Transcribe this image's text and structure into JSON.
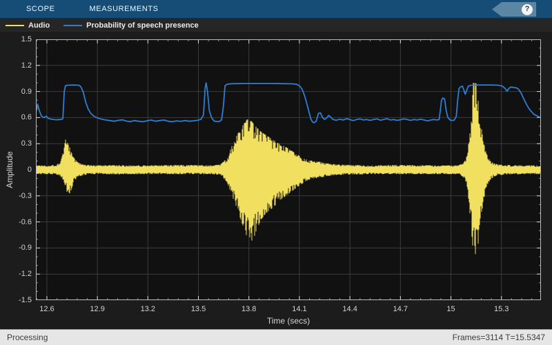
{
  "toolbar": {
    "tabs": [
      {
        "label": "SCOPE"
      },
      {
        "label": "MEASUREMENTS"
      }
    ],
    "help_label": "?"
  },
  "legend": {
    "items": [
      {
        "label": "Audio",
        "color": "#f1df5f"
      },
      {
        "label": "Probability of speech presence",
        "color": "#2e7ed4"
      }
    ]
  },
  "status_bar": {
    "left": "Processing",
    "right": "Frames=3114  T=15.5347"
  },
  "colors": {
    "plot_interior": "#111111",
    "grid": "#3c3c3c",
    "axis_border": "#bdbdbd",
    "major_tick": "#e0e0e0",
    "minor_tick": "#8f8f8f",
    "audio": "#f1df5f",
    "probability": "#2e7ed4"
  },
  "chart_data": {
    "type": "line",
    "title": "",
    "xlabel": "Time (secs)",
    "ylabel": "Amplitude",
    "xlim": [
      12.5347,
      15.5347
    ],
    "ylim": [
      -1.5,
      1.5
    ],
    "grid": true,
    "legend_position": "top-left-bar",
    "x_ticks": [
      {
        "v": 12.6,
        "label": "12.6"
      },
      {
        "v": 12.9,
        "label": "12.9"
      },
      {
        "v": 13.2,
        "label": "13.2"
      },
      {
        "v": 13.5,
        "label": "13.5"
      },
      {
        "v": 13.8,
        "label": "13.8"
      },
      {
        "v": 14.1,
        "label": "14.1"
      },
      {
        "v": 14.4,
        "label": "14.4"
      },
      {
        "v": 14.7,
        "label": "14.7"
      },
      {
        "v": 15,
        "label": "15"
      },
      {
        "v": 15.3,
        "label": "15.3"
      }
    ],
    "y_ticks": [
      {
        "v": 1.5,
        "label": "1.5"
      },
      {
        "v": 1.2,
        "label": "1.2"
      },
      {
        "v": 0.9,
        "label": "0.9"
      },
      {
        "v": 0.6,
        "label": "0.6"
      },
      {
        "v": 0.3,
        "label": "0.3"
      },
      {
        "v": 0,
        "label": "0"
      },
      {
        "v": -0.3,
        "label": "-0.3"
      },
      {
        "v": -0.6,
        "label": "-0.6"
      },
      {
        "v": -0.9,
        "label": "-0.9"
      },
      {
        "v": -1.2,
        "label": "-1.2"
      },
      {
        "v": -1.5,
        "label": "-1.5"
      }
    ],
    "x_minor_step": 0.06,
    "y_minor_step": 0.1,
    "series": [
      {
        "name": "Audio",
        "type": "waveform-envelope",
        "color": "#f1df5f",
        "envelope_format": [
          "time_secs",
          "pos_envelope",
          "neg_envelope"
        ],
        "envelope": [
          [
            12.5347,
            0.05,
            -0.05
          ],
          [
            12.6,
            0.05,
            -0.05
          ],
          [
            12.655,
            0.055,
            -0.055
          ],
          [
            12.68,
            0.09,
            -0.07
          ],
          [
            12.7,
            0.22,
            -0.13
          ],
          [
            12.712,
            0.37,
            -0.2
          ],
          [
            12.725,
            0.3,
            -0.3
          ],
          [
            12.74,
            0.24,
            -0.26
          ],
          [
            12.76,
            0.14,
            -0.14
          ],
          [
            12.78,
            0.09,
            -0.09
          ],
          [
            12.81,
            0.065,
            -0.065
          ],
          [
            12.86,
            0.05,
            -0.05
          ],
          [
            13.0,
            0.052,
            -0.052
          ],
          [
            13.2,
            0.05,
            -0.05
          ],
          [
            13.4,
            0.055,
            -0.05
          ],
          [
            13.58,
            0.05,
            -0.05
          ],
          [
            13.63,
            0.06,
            -0.06
          ],
          [
            13.67,
            0.13,
            -0.14
          ],
          [
            13.7,
            0.28,
            -0.3
          ],
          [
            13.73,
            0.4,
            -0.45
          ],
          [
            13.76,
            0.5,
            -0.62
          ],
          [
            13.79,
            0.58,
            -0.78
          ],
          [
            13.815,
            0.56,
            -0.88
          ],
          [
            13.84,
            0.5,
            -0.72
          ],
          [
            13.87,
            0.44,
            -0.58
          ],
          [
            13.9,
            0.4,
            -0.5
          ],
          [
            13.94,
            0.35,
            -0.44
          ],
          [
            13.98,
            0.3,
            -0.36
          ],
          [
            14.02,
            0.26,
            -0.3
          ],
          [
            14.06,
            0.21,
            -0.24
          ],
          [
            14.1,
            0.16,
            -0.18
          ],
          [
            14.14,
            0.12,
            -0.13
          ],
          [
            14.18,
            0.1,
            -0.1
          ],
          [
            14.22,
            0.09,
            -0.09
          ],
          [
            14.26,
            0.075,
            -0.075
          ],
          [
            14.32,
            0.06,
            -0.06
          ],
          [
            14.5,
            0.05,
            -0.05
          ],
          [
            14.7,
            0.055,
            -0.05
          ],
          [
            14.9,
            0.05,
            -0.05
          ],
          [
            15.04,
            0.05,
            -0.05
          ],
          [
            15.07,
            0.07,
            -0.08
          ],
          [
            15.09,
            0.12,
            -0.15
          ],
          [
            15.105,
            0.3,
            -0.35
          ],
          [
            15.12,
            0.55,
            -0.65
          ],
          [
            15.133,
            1.0,
            -0.97
          ],
          [
            15.158,
            0.99,
            -0.97
          ],
          [
            15.172,
            0.62,
            -0.68
          ],
          [
            15.188,
            0.38,
            -0.42
          ],
          [
            15.203,
            0.24,
            -0.27
          ],
          [
            15.22,
            0.14,
            -0.16
          ],
          [
            15.24,
            0.09,
            -0.1
          ],
          [
            15.27,
            0.065,
            -0.065
          ],
          [
            15.33,
            0.055,
            -0.055
          ],
          [
            15.45,
            0.05,
            -0.05
          ],
          [
            15.5347,
            0.05,
            -0.05
          ]
        ]
      },
      {
        "name": "Probability of speech presence",
        "type": "line",
        "color": "#2e7ed4",
        "points_format": [
          "time_secs",
          "probability"
        ],
        "points": [
          [
            12.535,
            0.66
          ],
          [
            12.545,
            0.755
          ],
          [
            12.555,
            0.68
          ],
          [
            12.567,
            0.62
          ],
          [
            12.58,
            0.6
          ],
          [
            12.597,
            0.615
          ],
          [
            12.61,
            0.59
          ],
          [
            12.63,
            0.58
          ],
          [
            12.655,
            0.575
          ],
          [
            12.68,
            0.578
          ],
          [
            12.695,
            0.585
          ],
          [
            12.703,
            0.9
          ],
          [
            12.71,
            0.965
          ],
          [
            12.72,
            0.972
          ],
          [
            12.76,
            0.975
          ],
          [
            12.79,
            0.972
          ],
          [
            12.802,
            0.955
          ],
          [
            12.815,
            0.9
          ],
          [
            12.83,
            0.78
          ],
          [
            12.845,
            0.7
          ],
          [
            12.862,
            0.645
          ],
          [
            12.88,
            0.615
          ],
          [
            12.9,
            0.597
          ],
          [
            12.925,
            0.582
          ],
          [
            12.95,
            0.572
          ],
          [
            12.975,
            0.565
          ],
          [
            13.0,
            0.558
          ],
          [
            13.025,
            0.568
          ],
          [
            13.05,
            0.574
          ],
          [
            13.07,
            0.56
          ],
          [
            13.095,
            0.553
          ],
          [
            13.12,
            0.565
          ],
          [
            13.145,
            0.558
          ],
          [
            13.17,
            0.552
          ],
          [
            13.195,
            0.563
          ],
          [
            13.22,
            0.572
          ],
          [
            13.245,
            0.558
          ],
          [
            13.27,
            0.565
          ],
          [
            13.295,
            0.572
          ],
          [
            13.32,
            0.558
          ],
          [
            13.345,
            0.552
          ],
          [
            13.37,
            0.562
          ],
          [
            13.395,
            0.556
          ],
          [
            13.42,
            0.565
          ],
          [
            13.445,
            0.558
          ],
          [
            13.47,
            0.562
          ],
          [
            13.495,
            0.568
          ],
          [
            13.515,
            0.58
          ],
          [
            13.53,
            0.63
          ],
          [
            13.54,
            0.94
          ],
          [
            13.546,
            1.0
          ],
          [
            13.554,
            0.9
          ],
          [
            13.565,
            0.68
          ],
          [
            13.578,
            0.6
          ],
          [
            13.592,
            0.562
          ],
          [
            13.61,
            0.553
          ],
          [
            13.625,
            0.556
          ],
          [
            13.638,
            0.575
          ],
          [
            13.648,
            0.72
          ],
          [
            13.658,
            0.965
          ],
          [
            13.672,
            0.985
          ],
          [
            13.7,
            0.99
          ],
          [
            13.78,
            0.992
          ],
          [
            13.86,
            0.992
          ],
          [
            13.94,
            0.992
          ],
          [
            14.02,
            0.99
          ],
          [
            14.06,
            0.988
          ],
          [
            14.085,
            0.982
          ],
          [
            14.1,
            0.965
          ],
          [
            14.115,
            0.93
          ],
          [
            14.13,
            0.855
          ],
          [
            14.145,
            0.755
          ],
          [
            14.158,
            0.655
          ],
          [
            14.168,
            0.585
          ],
          [
            14.178,
            0.548
          ],
          [
            14.19,
            0.542
          ],
          [
            14.2,
            0.56
          ],
          [
            14.213,
            0.648
          ],
          [
            14.225,
            0.655
          ],
          [
            14.237,
            0.6
          ],
          [
            14.25,
            0.578
          ],
          [
            14.263,
            0.6
          ],
          [
            14.275,
            0.625
          ],
          [
            14.288,
            0.6
          ],
          [
            14.3,
            0.578
          ],
          [
            14.32,
            0.57
          ],
          [
            14.34,
            0.582
          ],
          [
            14.36,
            0.572
          ],
          [
            14.38,
            0.588
          ],
          [
            14.4,
            0.576
          ],
          [
            14.42,
            0.565
          ],
          [
            14.44,
            0.578
          ],
          [
            14.46,
            0.585
          ],
          [
            14.48,
            0.572
          ],
          [
            14.5,
            0.578
          ],
          [
            14.52,
            0.568
          ],
          [
            14.54,
            0.578
          ],
          [
            14.56,
            0.585
          ],
          [
            14.58,
            0.57
          ],
          [
            14.6,
            0.578
          ],
          [
            14.62,
            0.588
          ],
          [
            14.64,
            0.572
          ],
          [
            14.66,
            0.578
          ],
          [
            14.68,
            0.568
          ],
          [
            14.7,
            0.575
          ],
          [
            14.72,
            0.585
          ],
          [
            14.74,
            0.578
          ],
          [
            14.76,
            0.568
          ],
          [
            14.78,
            0.578
          ],
          [
            14.8,
            0.572
          ],
          [
            14.82,
            0.582
          ],
          [
            14.84,
            0.572
          ],
          [
            14.86,
            0.562
          ],
          [
            14.88,
            0.572
          ],
          [
            14.9,
            0.578
          ],
          [
            14.915,
            0.572
          ],
          [
            14.93,
            0.578
          ],
          [
            14.938,
            0.7
          ],
          [
            14.944,
            0.8
          ],
          [
            14.952,
            0.825
          ],
          [
            14.962,
            0.815
          ],
          [
            14.972,
            0.68
          ],
          [
            14.982,
            0.6
          ],
          [
            14.995,
            0.572
          ],
          [
            15.008,
            0.565
          ],
          [
            15.02,
            0.572
          ],
          [
            15.032,
            0.615
          ],
          [
            15.04,
            0.8
          ],
          [
            15.048,
            0.935
          ],
          [
            15.058,
            0.955
          ],
          [
            15.068,
            0.962
          ],
          [
            15.076,
            0.92
          ],
          [
            15.085,
            0.868
          ],
          [
            15.093,
            0.91
          ],
          [
            15.103,
            0.962
          ],
          [
            15.12,
            0.972
          ],
          [
            15.16,
            0.975
          ],
          [
            15.2,
            0.975
          ],
          [
            15.24,
            0.975
          ],
          [
            15.28,
            0.972
          ],
          [
            15.305,
            0.962
          ],
          [
            15.322,
            0.935
          ],
          [
            15.333,
            0.902
          ],
          [
            15.345,
            0.938
          ],
          [
            15.358,
            0.952
          ],
          [
            15.372,
            0.945
          ],
          [
            15.388,
            0.942
          ],
          [
            15.402,
            0.925
          ],
          [
            15.418,
            0.878
          ],
          [
            15.432,
            0.818
          ],
          [
            15.448,
            0.755
          ],
          [
            15.463,
            0.705
          ],
          [
            15.478,
            0.668
          ],
          [
            15.493,
            0.638
          ],
          [
            15.508,
            0.622
          ],
          [
            15.522,
            0.61
          ],
          [
            15.5347,
            0.6
          ]
        ]
      }
    ]
  }
}
